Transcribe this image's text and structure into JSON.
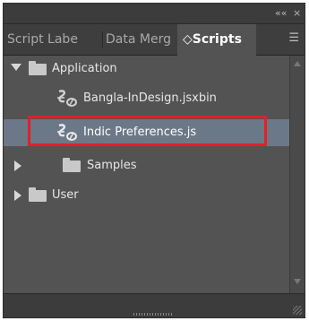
{
  "panel": {
    "top_controls": {
      "collapse": "««",
      "close": "×"
    },
    "tabs": [
      {
        "label": "Script Labe"
      },
      {
        "label": "Data Merg"
      },
      {
        "label": "◇Scripts"
      }
    ],
    "menu_glyph": "☰"
  },
  "tree": {
    "application_label": "Application",
    "script_1": "Bangla-InDesign.jsxbin",
    "script_2": "Indic Preferences.js",
    "samples_label": "Samples",
    "user_label": "User"
  },
  "colors": {
    "panel_bg": "#535353",
    "selected_row": "#6b7888",
    "highlight_outline": "#e0202a"
  }
}
